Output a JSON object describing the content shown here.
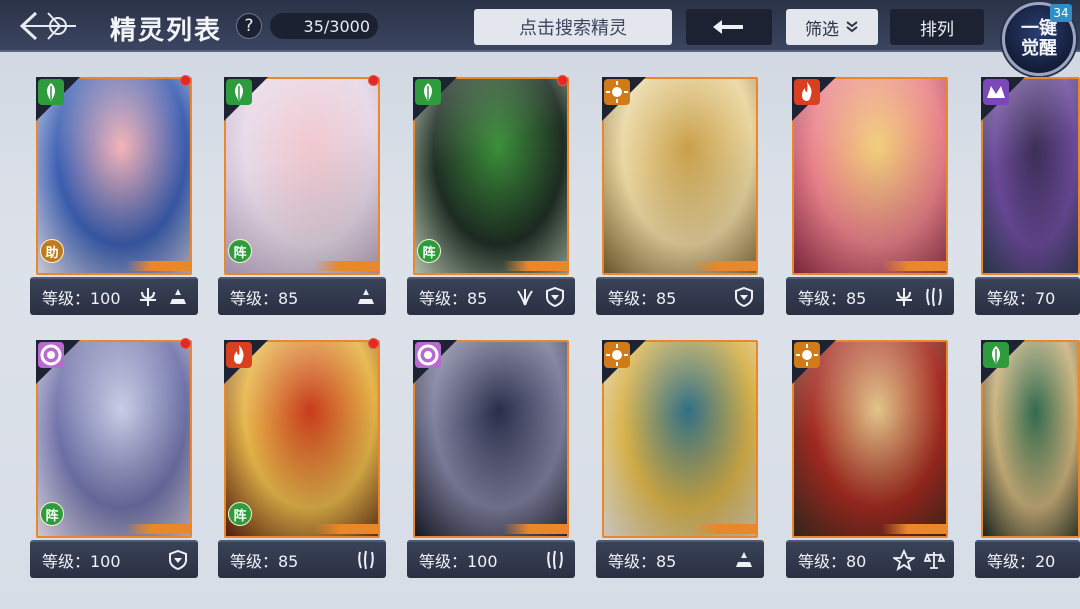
{
  "header": {
    "title": "精灵列表",
    "help": "?",
    "count": "35/3000",
    "search_placeholder": "点击搜索精灵",
    "filter_label": "筛选",
    "sort_label": "排列",
    "awaken_label": "一键觉醒",
    "awaken_badge": "34"
  },
  "cards": [
    {
      "level": "等级：100",
      "element": "leaf",
      "element_color": "#2e9b3c",
      "role": "助",
      "role_color": "#c07a1c",
      "new": true,
      "art": [
        "#f5b4b8",
        "#3b5fb2",
        "#e8e2ee"
      ],
      "icons": [
        "trident-icon",
        "rank-icon"
      ]
    },
    {
      "level": "等级：85",
      "element": "leaf",
      "element_color": "#2e9b3c",
      "role": "阵",
      "role_color": "#2e9b3c",
      "new": true,
      "art": [
        "#f2c8cf",
        "#e6d8e6",
        "#b7a4c2"
      ],
      "icons": [
        "rank-icon"
      ]
    },
    {
      "level": "等级：85",
      "element": "leaf",
      "element_color": "#2e9b3c",
      "role": "阵",
      "role_color": "#2e9b3c",
      "new": true,
      "art": [
        "#3b8f3a",
        "#1f2e24",
        "#c7d6c0"
      ],
      "icons": [
        "wing-icon",
        "shield-icon"
      ]
    },
    {
      "level": "等级：85",
      "element": "sun",
      "element_color": "#d07a18",
      "role": "",
      "role_color": "",
      "new": false,
      "art": [
        "#c9a04a",
        "#ead6a0",
        "#7a6230"
      ],
      "icons": [
        "shield-icon"
      ]
    },
    {
      "level": "等级：85",
      "element": "fire",
      "element_color": "#d8401f",
      "role": "",
      "role_color": "",
      "new": false,
      "art": [
        "#f2cf7a",
        "#e9818a",
        "#8c2a44"
      ],
      "icons": [
        "trident-icon",
        "claw-icon"
      ]
    },
    {
      "level": "等级：70",
      "element": "dark",
      "element_color": "#7b47b9",
      "role": "",
      "role_color": "",
      "new": false,
      "art": [
        "#3a2d55",
        "#6c4b9b",
        "#2c3f52"
      ],
      "icons": []
    },
    {
      "level": "等级：100",
      "element": "rainbow",
      "element_color": "#b86ad0",
      "role": "阵",
      "role_color": "#2e9b3c",
      "new": true,
      "art": [
        "#c7cde6",
        "#6f72a8",
        "#e8e0ee"
      ],
      "icons": [
        "shield-icon"
      ]
    },
    {
      "level": "等级：85",
      "element": "fire",
      "element_color": "#d8401f",
      "role": "阵",
      "role_color": "#2e9b3c",
      "new": true,
      "art": [
        "#c83a1c",
        "#e6b64a",
        "#5a2010"
      ],
      "icons": [
        "claw-icon"
      ]
    },
    {
      "level": "等级：100",
      "element": "rainbow",
      "element_color": "#b86ad0",
      "role": "",
      "role_color": "",
      "new": false,
      "art": [
        "#2a2d4a",
        "#7d7f9c",
        "#1b1c2a"
      ],
      "icons": [
        "claw-icon"
      ]
    },
    {
      "level": "等级：85",
      "element": "sun",
      "element_color": "#d07a18",
      "role": "",
      "role_color": "",
      "new": false,
      "art": [
        "#2f6f86",
        "#d8b24a",
        "#e4e1d8"
      ],
      "icons": [
        "rank-icon"
      ]
    },
    {
      "level": "等级：80",
      "element": "sun",
      "element_color": "#d07a18",
      "role": "",
      "role_color": "",
      "new": false,
      "art": [
        "#e2c58a",
        "#a32a20",
        "#3b2a1e"
      ],
      "icons": [
        "star-icon",
        "scale-icon"
      ]
    },
    {
      "level": "等级：20",
      "element": "leaf",
      "element_color": "#2e9b3c",
      "role": "",
      "role_color": "",
      "new": false,
      "art": [
        "#2f6a4e",
        "#c9b07a",
        "#1e2a22"
      ],
      "icons": []
    }
  ]
}
